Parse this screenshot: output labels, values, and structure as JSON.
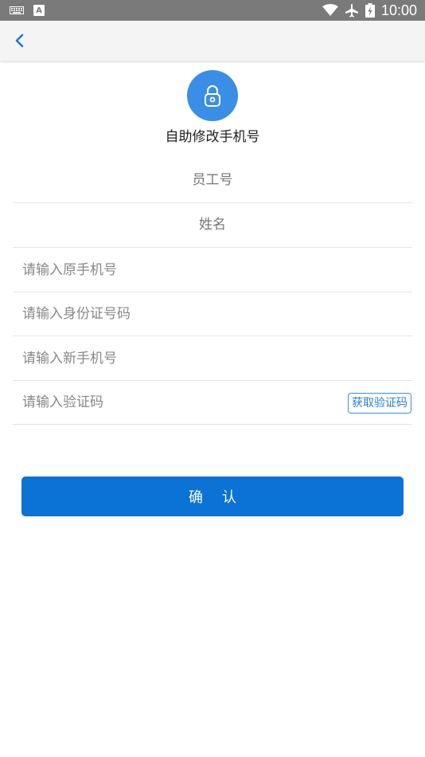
{
  "status_bar": {
    "time": "10:00",
    "keyboard_icon": "keyboard-icon",
    "a_icon_label": "A",
    "wifi_icon": "wifi-icon",
    "airplane_icon": "airplane-icon",
    "battery_icon": "battery-icon"
  },
  "app_bar": {
    "back_icon": "chevron-left-icon"
  },
  "header": {
    "icon": "lock-icon",
    "title": "自助修改手机号"
  },
  "form": {
    "employee_id": "员工号",
    "name": "姓名",
    "old_phone_placeholder": "请输入原手机号",
    "id_card_placeholder": "请输入身份证号码",
    "new_phone_placeholder": "请输入新手机号",
    "code_placeholder": "请输入验证码",
    "get_code_label": "获取验证码"
  },
  "confirm_label": "确认",
  "colors": {
    "accent": "#3a8ee6",
    "primary_button": "#0b72d6",
    "status_bar": "#7a7a7a",
    "app_bar": "#f4f4f4"
  }
}
